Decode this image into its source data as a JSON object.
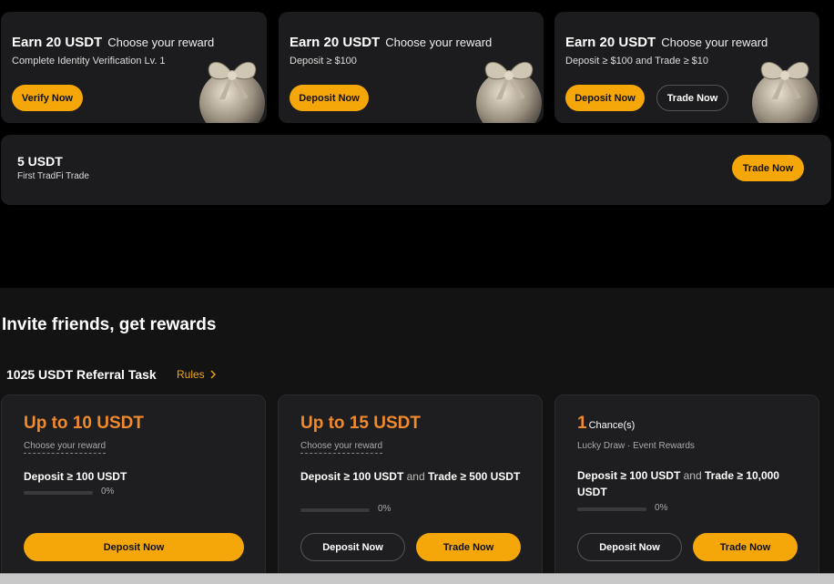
{
  "top_cards": [
    {
      "amount": "Earn 20 USDT",
      "choose": "Choose your reward",
      "requirement": "Complete Identity Verification Lv. 1",
      "primary_button": "Verify Now"
    },
    {
      "amount": "Earn 20 USDT",
      "choose": "Choose your reward",
      "requirement": "Deposit ≥ $100",
      "primary_button": "Deposit Now"
    },
    {
      "amount": "Earn 20 USDT",
      "choose": "Choose your reward",
      "requirement": "Deposit ≥ $100 and Trade ≥ $10",
      "primary_button": "Deposit Now",
      "secondary_button": "Trade Now"
    }
  ],
  "wide_card": {
    "amount": "5 USDT",
    "requirement": "First TradFi Trade",
    "button": "Trade Now"
  },
  "invite": {
    "heading": "Invite friends, get rewards",
    "task_title": "1025 USDT Referral Task",
    "rules_label": "Rules"
  },
  "referral_cards": [
    {
      "amount": "Up to 10 USDT",
      "choose": "Choose your reward",
      "deposit_req": "Deposit ≥ 100 USDT",
      "progress_label": "0%",
      "progress": 0,
      "primary_button": "Deposit Now"
    },
    {
      "amount": "Up to 15 USDT",
      "choose": "Choose your reward",
      "deposit_req": "Deposit ≥ 100 USDT",
      "and_text": "and",
      "trade_req": "Trade ≥ 500 USDT",
      "progress_label": "0%",
      "progress": 0,
      "outline_button": "Deposit Now",
      "primary_button": "Trade Now"
    },
    {
      "count": "1",
      "count_label": "Chance(s)",
      "choose": "Lucky Draw · Event Rewards",
      "deposit_req": "Deposit ≥ 100 USDT",
      "and_text": "and",
      "trade_req": "Trade ≥ 10,000 USDT",
      "progress_label": "0%",
      "progress": 0,
      "outline_button": "Deposit Now",
      "primary_button": "Trade Now"
    }
  ],
  "colors": {
    "accent": "#f5a70a",
    "amount_orange": "#f08a2c",
    "card_bg": "#1c1c1e"
  }
}
